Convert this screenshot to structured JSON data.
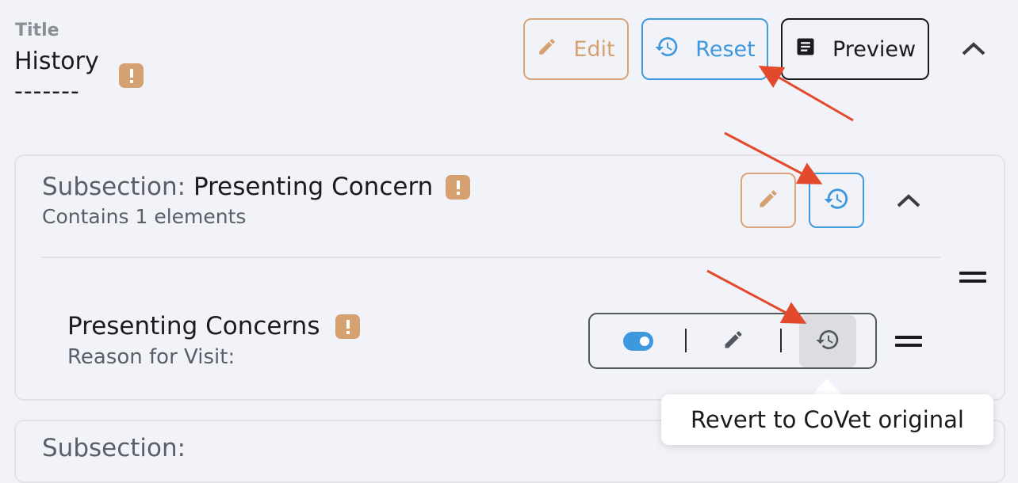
{
  "title": {
    "label": "Title",
    "value": "History",
    "underline": "-------"
  },
  "toolbar": {
    "edit_label": "Edit",
    "reset_label": "Reset",
    "preview_label": "Preview"
  },
  "subsection": {
    "prefix": "Subsection:",
    "name": "Presenting Concern",
    "meta": "Contains 1 elements"
  },
  "element": {
    "name": "Presenting Concerns",
    "meta": "Reason for Visit:"
  },
  "subsection2": {
    "prefix": "Subsection:"
  },
  "tooltip": {
    "text": "Revert to CoVet original"
  },
  "colors": {
    "warning": "#d6a171",
    "accent_blue": "#3e98de",
    "bg": "#f2f3f8",
    "arrow_red": "#e34a2c"
  },
  "icons": [
    "pencil-icon",
    "history-icon",
    "document-icon",
    "chevron-up-icon",
    "warning-icon",
    "drag-handle-icon",
    "toggle-switch"
  ]
}
